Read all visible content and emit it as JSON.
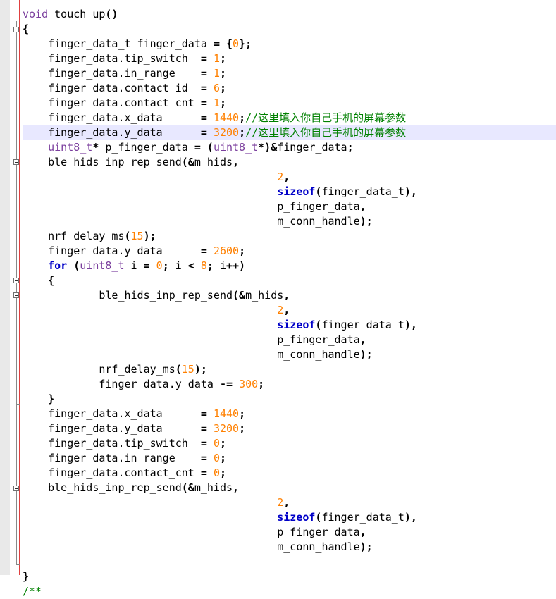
{
  "editor": {
    "lines": [
      {
        "t": "void touch_up()",
        "parts": [
          [
            "ty",
            "void"
          ],
          [
            "fn",
            " touch_up"
          ],
          [
            "op",
            "()"
          ]
        ]
      },
      {
        "parts": [
          [
            "op",
            "{"
          ]
        ]
      },
      {
        "parts": [
          [
            "fn",
            "    finger_data_t finger_data "
          ],
          [
            "op",
            "="
          ],
          [
            "fn",
            " "
          ],
          [
            "op",
            "{"
          ],
          [
            "num",
            "0"
          ],
          [
            "op",
            "};"
          ]
        ]
      },
      {
        "parts": [
          [
            "fn",
            "    finger_data.tip_switch  "
          ],
          [
            "op",
            "="
          ],
          [
            "fn",
            " "
          ],
          [
            "num",
            "1"
          ],
          [
            "op",
            ";"
          ]
        ]
      },
      {
        "parts": [
          [
            "fn",
            "    finger_data.in_range    "
          ],
          [
            "op",
            "="
          ],
          [
            "fn",
            " "
          ],
          [
            "num",
            "1"
          ],
          [
            "op",
            ";"
          ]
        ]
      },
      {
        "parts": [
          [
            "fn",
            "    finger_data.contact_id  "
          ],
          [
            "op",
            "="
          ],
          [
            "fn",
            " "
          ],
          [
            "num",
            "6"
          ],
          [
            "op",
            ";"
          ]
        ]
      },
      {
        "parts": [
          [
            "fn",
            "    finger_data.contact_cnt "
          ],
          [
            "op",
            "="
          ],
          [
            "fn",
            " "
          ],
          [
            "num",
            "1"
          ],
          [
            "op",
            ";"
          ]
        ]
      },
      {
        "parts": [
          [
            "fn",
            "    finger_data.x_data      "
          ],
          [
            "op",
            "="
          ],
          [
            "fn",
            " "
          ],
          [
            "num",
            "1440"
          ],
          [
            "op",
            ";"
          ],
          [
            "cm",
            "//这里填入你自己手机的屏幕参数"
          ]
        ]
      },
      {
        "parts": [
          [
            "fn",
            "    finger_data.y_data      "
          ],
          [
            "op",
            "="
          ],
          [
            "fn",
            " "
          ],
          [
            "num",
            "3200"
          ],
          [
            "op",
            ";"
          ],
          [
            "cm",
            "//这里填入你自己手机的屏幕参数"
          ]
        ]
      },
      {
        "parts": [
          [
            "ty",
            "    uint8_t"
          ],
          [
            "op",
            "*"
          ],
          [
            "fn",
            " p_finger_data "
          ],
          [
            "op",
            "="
          ],
          [
            "fn",
            " "
          ],
          [
            "op",
            "("
          ],
          [
            "ty",
            "uint8_t"
          ],
          [
            "op",
            "*)&"
          ],
          [
            "fn",
            "finger_data"
          ],
          [
            "op",
            ";"
          ]
        ]
      },
      {
        "parts": [
          [
            "fn",
            "    ble_hids_inp_rep_send"
          ],
          [
            "op",
            "(&"
          ],
          [
            "fn",
            "m_hids"
          ],
          [
            "op",
            ","
          ]
        ]
      },
      {
        "parts": [
          [
            "fn",
            "                                        "
          ],
          [
            "num",
            "2"
          ],
          [
            "op",
            ","
          ]
        ]
      },
      {
        "parts": [
          [
            "fn",
            "                                        "
          ],
          [
            "kw",
            "sizeof"
          ],
          [
            "op",
            "("
          ],
          [
            "fn",
            "finger_data_t"
          ],
          [
            "op",
            "),"
          ]
        ]
      },
      {
        "parts": [
          [
            "fn",
            "                                        p_finger_data"
          ],
          [
            "op",
            ","
          ]
        ]
      },
      {
        "parts": [
          [
            "fn",
            "                                        m_conn_handle"
          ],
          [
            "op",
            ");"
          ]
        ]
      },
      {
        "parts": [
          [
            "fn",
            "    nrf_delay_ms"
          ],
          [
            "op",
            "("
          ],
          [
            "num",
            "15"
          ],
          [
            "op",
            ");"
          ]
        ]
      },
      {
        "parts": [
          [
            "fn",
            "    finger_data.y_data      "
          ],
          [
            "op",
            "="
          ],
          [
            "fn",
            " "
          ],
          [
            "num",
            "2600"
          ],
          [
            "op",
            ";"
          ]
        ]
      },
      {
        "parts": [
          [
            "kw",
            "    for"
          ],
          [
            "fn",
            " "
          ],
          [
            "op",
            "("
          ],
          [
            "ty",
            "uint8_t"
          ],
          [
            "fn",
            " i "
          ],
          [
            "op",
            "="
          ],
          [
            "fn",
            " "
          ],
          [
            "num",
            "0"
          ],
          [
            "op",
            ";"
          ],
          [
            "fn",
            " i "
          ],
          [
            "op",
            "<"
          ],
          [
            "fn",
            " "
          ],
          [
            "num",
            "8"
          ],
          [
            "op",
            ";"
          ],
          [
            "fn",
            " i"
          ],
          [
            "op",
            "++)"
          ]
        ]
      },
      {
        "parts": [
          [
            "op",
            "    {"
          ]
        ]
      },
      {
        "parts": [
          [
            "fn",
            "            ble_hids_inp_rep_send"
          ],
          [
            "op",
            "(&"
          ],
          [
            "fn",
            "m_hids"
          ],
          [
            "op",
            ","
          ]
        ]
      },
      {
        "parts": [
          [
            "fn",
            "                                        "
          ],
          [
            "num",
            "2"
          ],
          [
            "op",
            ","
          ]
        ]
      },
      {
        "parts": [
          [
            "fn",
            "                                        "
          ],
          [
            "kw",
            "sizeof"
          ],
          [
            "op",
            "("
          ],
          [
            "fn",
            "finger_data_t"
          ],
          [
            "op",
            "),"
          ]
        ]
      },
      {
        "parts": [
          [
            "fn",
            "                                        p_finger_data"
          ],
          [
            "op",
            ","
          ]
        ]
      },
      {
        "parts": [
          [
            "fn",
            "                                        m_conn_handle"
          ],
          [
            "op",
            ");"
          ]
        ]
      },
      {
        "parts": [
          [
            "fn",
            "            nrf_delay_ms"
          ],
          [
            "op",
            "("
          ],
          [
            "num",
            "15"
          ],
          [
            "op",
            ");"
          ]
        ]
      },
      {
        "parts": [
          [
            "fn",
            "            finger_data.y_data "
          ],
          [
            "op",
            "-="
          ],
          [
            "fn",
            " "
          ],
          [
            "num",
            "300"
          ],
          [
            "op",
            ";"
          ]
        ]
      },
      {
        "parts": [
          [
            "op",
            "    }"
          ]
        ]
      },
      {
        "parts": [
          [
            "fn",
            "    finger_data.x_data      "
          ],
          [
            "op",
            "="
          ],
          [
            "fn",
            " "
          ],
          [
            "num",
            "1440"
          ],
          [
            "op",
            ";"
          ]
        ]
      },
      {
        "parts": [
          [
            "fn",
            "    finger_data.y_data      "
          ],
          [
            "op",
            "="
          ],
          [
            "fn",
            " "
          ],
          [
            "num",
            "3200"
          ],
          [
            "op",
            ";"
          ]
        ]
      },
      {
        "parts": [
          [
            "fn",
            "    finger_data.tip_switch  "
          ],
          [
            "op",
            "="
          ],
          [
            "fn",
            " "
          ],
          [
            "num",
            "0"
          ],
          [
            "op",
            ";"
          ]
        ]
      },
      {
        "parts": [
          [
            "fn",
            "    finger_data.in_range    "
          ],
          [
            "op",
            "="
          ],
          [
            "fn",
            " "
          ],
          [
            "num",
            "0"
          ],
          [
            "op",
            ";"
          ]
        ]
      },
      {
        "parts": [
          [
            "fn",
            "    finger_data.contact_cnt "
          ],
          [
            "op",
            "="
          ],
          [
            "fn",
            " "
          ],
          [
            "num",
            "0"
          ],
          [
            "op",
            ";"
          ]
        ]
      },
      {
        "parts": [
          [
            "fn",
            "    ble_hids_inp_rep_send"
          ],
          [
            "op",
            "(&"
          ],
          [
            "fn",
            "m_hids"
          ],
          [
            "op",
            ","
          ]
        ]
      },
      {
        "parts": [
          [
            "fn",
            "                                        "
          ],
          [
            "num",
            "2"
          ],
          [
            "op",
            ","
          ]
        ]
      },
      {
        "parts": [
          [
            "fn",
            "                                        "
          ],
          [
            "kw",
            "sizeof"
          ],
          [
            "op",
            "("
          ],
          [
            "fn",
            "finger_data_t"
          ],
          [
            "op",
            "),"
          ]
        ]
      },
      {
        "parts": [
          [
            "fn",
            "                                        p_finger_data"
          ],
          [
            "op",
            ","
          ]
        ]
      },
      {
        "parts": [
          [
            "fn",
            "                                        m_conn_handle"
          ],
          [
            "op",
            ");"
          ]
        ]
      },
      {
        "parts": [
          [
            "op",
            ""
          ]
        ]
      },
      {
        "parts": [
          [
            "op",
            "}"
          ]
        ]
      },
      {
        "parts": [
          [
            "cm",
            "/**"
          ]
        ]
      }
    ],
    "colors": {
      "keyword": "#0000c8",
      "type": "#7a3e9d",
      "number": "#ff8000",
      "comment": "#008000",
      "current_line": "#e8e8ff",
      "edge_line": "#e04040"
    }
  }
}
